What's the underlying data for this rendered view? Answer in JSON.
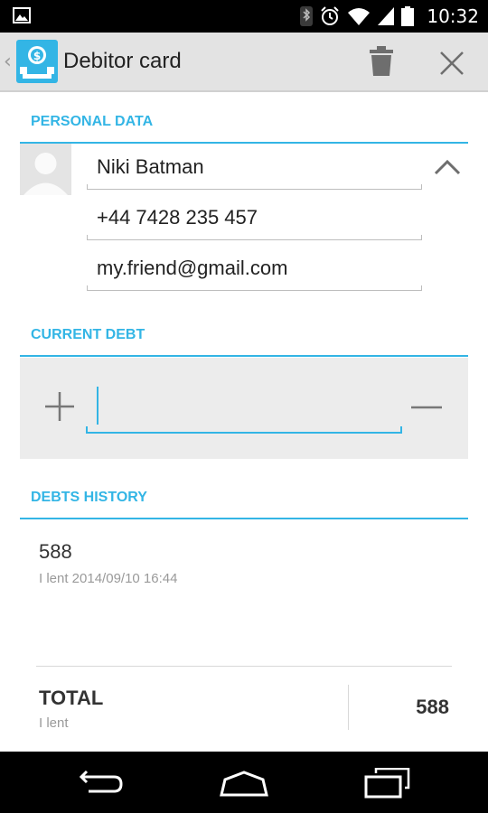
{
  "status_bar": {
    "time": "10:32",
    "icons": [
      "image-icon",
      "bluetooth-icon",
      "alarm-icon",
      "wifi-icon",
      "signal-icon",
      "battery-icon"
    ]
  },
  "action_bar": {
    "title": "Debitor card",
    "icons": [
      "up-chevron-icon",
      "app-icon",
      "trash-icon",
      "close-icon"
    ]
  },
  "personal_data": {
    "header": "PERSONAL DATA",
    "name": "Niki Batman",
    "phone": "+44 7428 235 457",
    "email": "my.friend@gmail.com"
  },
  "current_debt": {
    "header": "CURRENT DEBT",
    "value": "",
    "icons": [
      "plus-icon",
      "minus-icon"
    ]
  },
  "debts_history": {
    "header": "DEBTS HISTORY",
    "items": [
      {
        "amount": "588",
        "detail": "I lent 2014/09/10 16:44"
      }
    ]
  },
  "total": {
    "label": "TOTAL",
    "sub": "I lent",
    "value": "588"
  },
  "nav_bar": {
    "icons": [
      "back-icon",
      "home-icon",
      "recents-icon"
    ]
  },
  "colors": {
    "accent": "#33b5e5",
    "action_bar": "#e3e3e3",
    "panel": "#ececec"
  }
}
